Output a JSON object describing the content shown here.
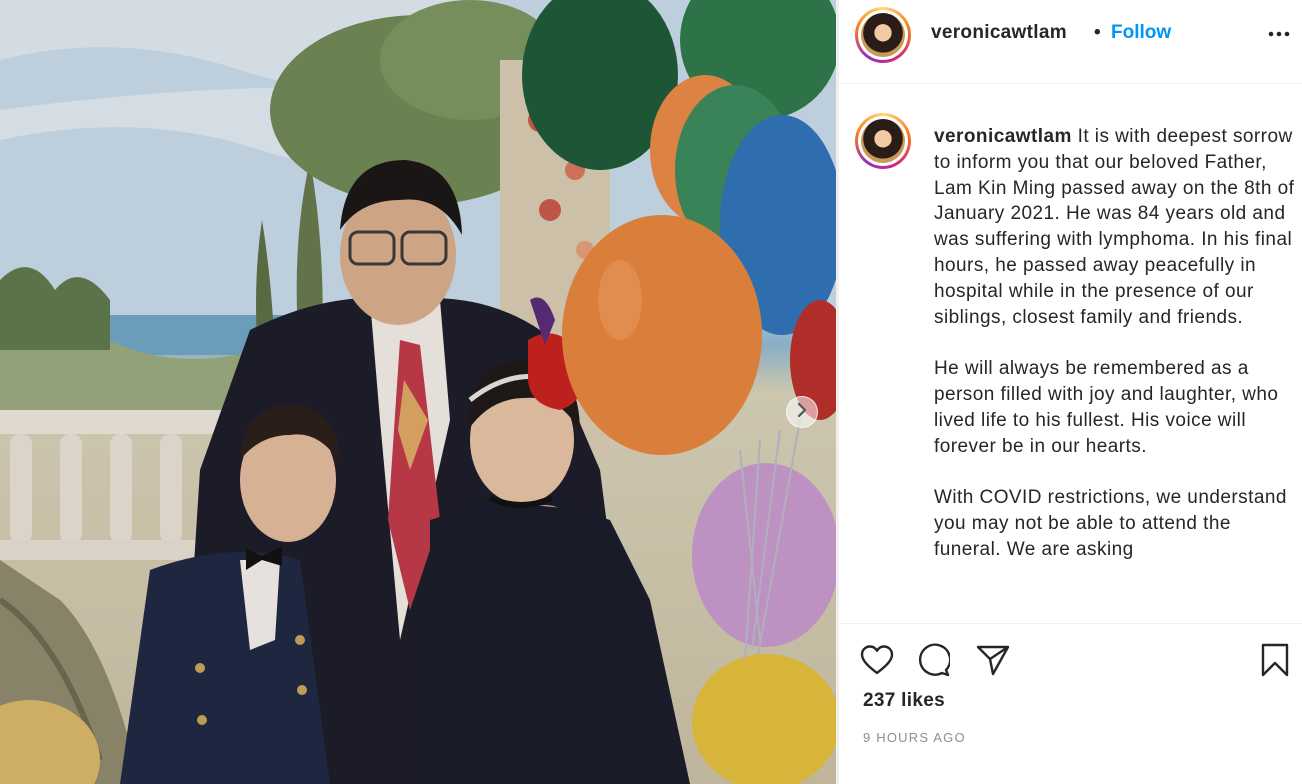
{
  "post": {
    "username": "veronicawtlam",
    "follow_label": "Follow",
    "separator": "•",
    "more_icon": "more-horizontal-icon",
    "next_icon": "chevron-right-icon",
    "caption": {
      "username": "veronicawtlam",
      "paragraph_1": "It is with deepest sorrow to inform you that our beloved Father, Lam Kin Ming passed away on the 8th of January 2021. He was 84 years old and was suffering with lymphoma. In his final hours, he passed away peacefully in hospital while in the presence of our siblings, closest family and friends.",
      "paragraph_2": "He will always be remembered as a person filled with joy and laughter, who lived life to his fullest. His voice will forever be in our hearts.",
      "paragraph_3": "With COVID restrictions, we understand you may not be able to attend the funeral. We are asking"
    },
    "actions": {
      "like_icon": "heart-icon",
      "comment_icon": "comment-icon",
      "share_icon": "share-icon",
      "save_icon": "bookmark-icon"
    },
    "likes": "237 likes",
    "time": "9 HOURS AGO"
  },
  "colors": {
    "link_blue": "#0095f6",
    "text": "#262626",
    "muted": "#8e8e8e",
    "border": "#efefef"
  }
}
